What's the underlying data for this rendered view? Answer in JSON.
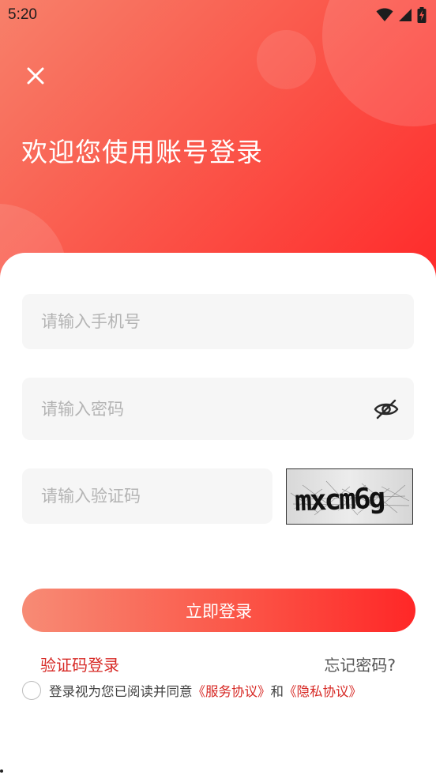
{
  "status_bar": {
    "time": "5:20",
    "icons": [
      "wifi-icon",
      "signal-icon",
      "battery-charging-icon"
    ]
  },
  "header": {
    "close_icon": "close-icon",
    "title": "欢迎您使用账号登录"
  },
  "form": {
    "phone_placeholder": "请输入手机号",
    "password_placeholder": "请输入密码",
    "password_visibility_icon": "eye-off-icon",
    "code_placeholder": "请输入验证码",
    "captcha_text": "mxcm6g"
  },
  "actions": {
    "login_label": "立即登录",
    "sms_login_label": "验证码登录",
    "forgot_label": "忘记密码?"
  },
  "agreement": {
    "prefix": "登录视为您已阅读并同意",
    "service_link": "《服务协议》",
    "connector": "和",
    "privacy_link": "《隐私协议》"
  },
  "colors": {
    "accent": "#ff2a2a",
    "gradient_start": "#f7806a",
    "link_red": "#d72a26"
  }
}
